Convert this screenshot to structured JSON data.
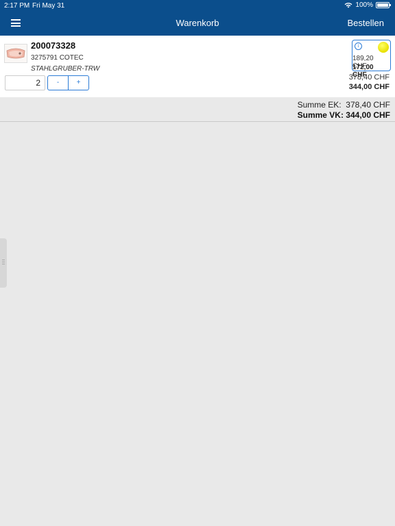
{
  "status_bar": {
    "time": "2:17 PM",
    "date": "Fri May 31",
    "battery": "100%"
  },
  "header": {
    "title": "Warenkorb",
    "order_button": "Bestellen"
  },
  "cart": {
    "items": [
      {
        "article_number": "200073328",
        "reference": "3275791 COTEC",
        "brand": "STAHLGRUBER-TRW",
        "quantity": "2",
        "decrement_label": "-",
        "increment_label": "+",
        "unit_price_ek": "189,20 CHF",
        "unit_price_vk": "172,00 CHF",
        "line_total_ek": "378,40 CHF",
        "line_total_vk": "344,00 CHF",
        "availability_color": "#e8e000"
      }
    ]
  },
  "totals": {
    "sum_ek": "Summe EK:  378,40 CHF",
    "sum_vk": "Summe VK: 344,00 CHF"
  },
  "icons": {
    "menu": "hamburger-menu-icon",
    "info": "info-icon",
    "availability": "availability-dot-icon",
    "wifi": "wifi-icon",
    "battery": "battery-icon"
  },
  "colors": {
    "header_bg": "#0b4e8c",
    "accent": "#2b7bd6",
    "background": "#e9e9e9"
  }
}
